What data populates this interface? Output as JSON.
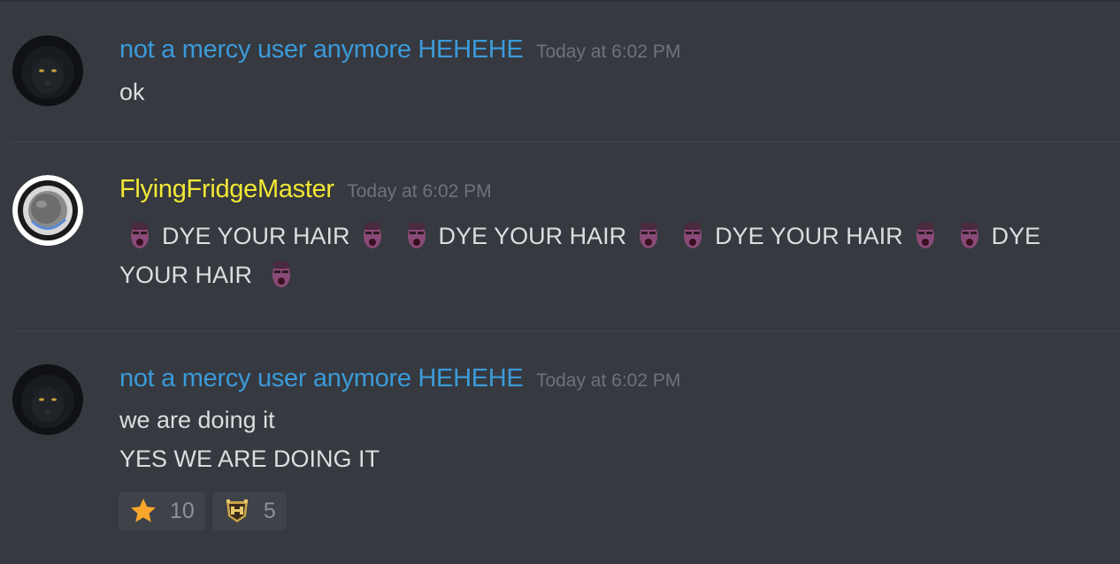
{
  "messages": [
    {
      "author": "not a mercy user anymore HEHEHE",
      "author_color": "#3b9ad9",
      "avatar": "black-panther-avatar",
      "timestamp": "Today at 6:02 PM",
      "lines": [
        "ok"
      ]
    },
    {
      "author": "FlyingFridgeMaster",
      "author_color": "#f2e835",
      "avatar": "silver-ring-avatar",
      "timestamp": "Today at 6:02 PM",
      "lines": [
        "DYE YOUR HAIR",
        "DYE YOUR HAIR",
        "DYE YOUR HAIR",
        "DYE",
        "YOUR HAIR"
      ],
      "emoji_icon": "shouting-face-emoji"
    },
    {
      "author": "not a mercy user anymore HEHEHE",
      "author_color": "#3b9ad9",
      "avatar": "black-panther-avatar",
      "timestamp": "Today at 6:02 PM",
      "lines": [
        "we are doing it",
        "YES WE ARE DOING IT"
      ],
      "reactions": [
        {
          "icon": "star-icon",
          "count": "10"
        },
        {
          "icon": "overwatch-badge-icon",
          "count": "5"
        }
      ]
    }
  ]
}
